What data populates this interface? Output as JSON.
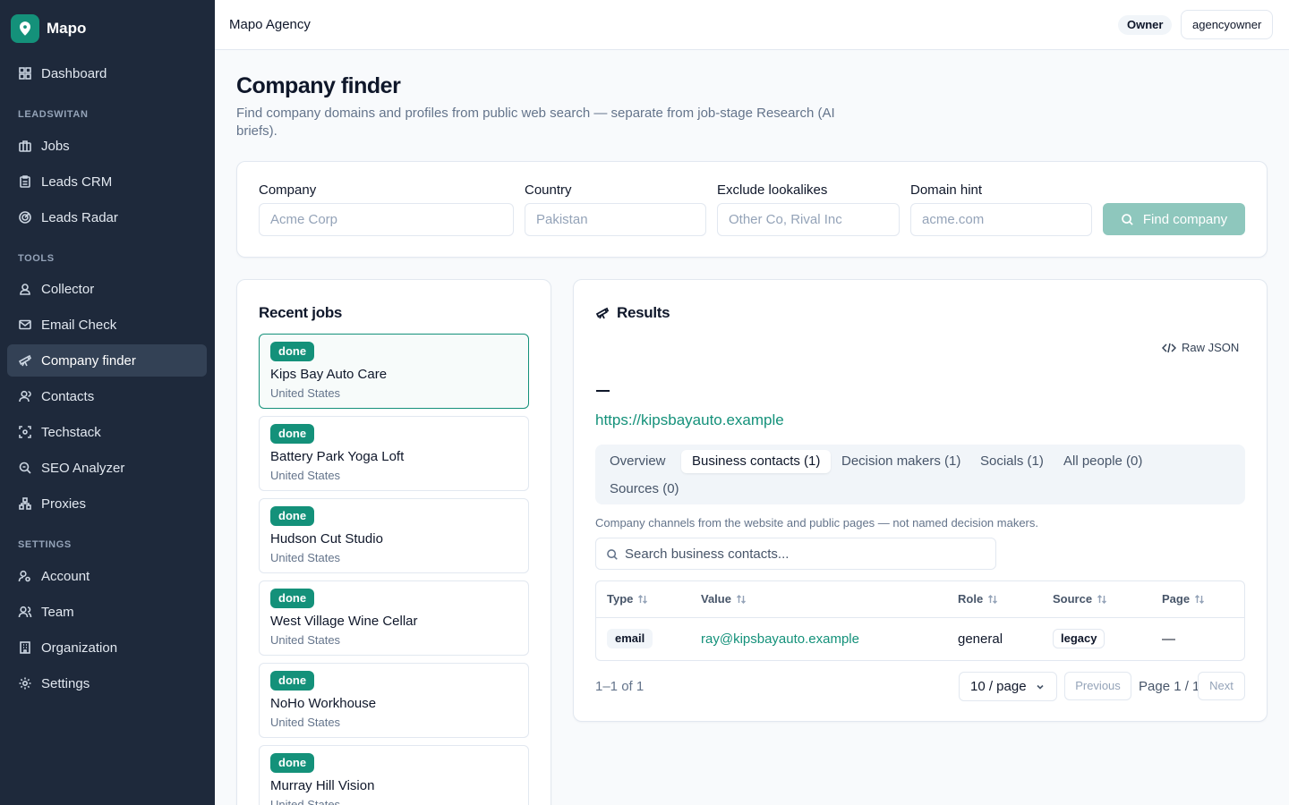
{
  "brand": {
    "name": "Mapo"
  },
  "sidebar": {
    "dashboard": "Dashboard",
    "sections": {
      "leadswitan": "LEADSWITAN",
      "tools": "TOOLS",
      "settings": "SETTINGS"
    },
    "items": {
      "jobs": "Jobs",
      "leads_crm": "Leads CRM",
      "leads_radar": "Leads Radar",
      "collector": "Collector",
      "email_check": "Email Check",
      "company_finder": "Company finder",
      "contacts": "Contacts",
      "techstack": "Techstack",
      "seo_analyzer": "SEO Analyzer",
      "proxies": "Proxies",
      "account": "Account",
      "team": "Team",
      "organization": "Organization",
      "settings": "Settings"
    },
    "active_item": "Company finder"
  },
  "topbar": {
    "org": "Mapo Agency",
    "role": "Owner",
    "user": "agencyowner"
  },
  "page": {
    "title": "Company finder",
    "description": "Find company domains and profiles from public web search — separate from job-stage Research (AI briefs)."
  },
  "form": {
    "company": {
      "label": "Company",
      "placeholder": "Acme Corp"
    },
    "country": {
      "label": "Country",
      "placeholder": "Pakistan"
    },
    "exclude": {
      "label": "Exclude lookalikes",
      "placeholder": "Other Co, Rival Inc"
    },
    "domain": {
      "label": "Domain hint",
      "placeholder": "acme.com"
    },
    "submit": "Find company"
  },
  "recent_jobs": {
    "title": "Recent jobs",
    "items": [
      {
        "status": "done",
        "name": "Kips Bay Auto Care",
        "country": "United States"
      },
      {
        "status": "done",
        "name": "Battery Park Yoga Loft",
        "country": "United States"
      },
      {
        "status": "done",
        "name": "Hudson Cut Studio",
        "country": "United States"
      },
      {
        "status": "done",
        "name": "West Village Wine Cellar",
        "country": "United States"
      },
      {
        "status": "done",
        "name": "NoHo Workhouse",
        "country": "United States"
      },
      {
        "status": "done",
        "name": "Murray Hill Vision",
        "country": "United States"
      }
    ]
  },
  "results": {
    "title": "Results",
    "raw_json": "Raw JSON",
    "url": "https://kipsbayauto.example",
    "tabs": [
      "Overview",
      "Business contacts (1)",
      "Decision makers (1)",
      "Socials (1)",
      "All people (0)",
      "Sources (0)"
    ],
    "active_tab": "Business contacts (1)",
    "hint": "Company channels from the website and public pages — not named decision makers.",
    "search_placeholder": "Search business contacts...",
    "table": {
      "headers": [
        "Type",
        "Value",
        "Role",
        "Source",
        "Page"
      ],
      "rows": [
        {
          "type": "email",
          "value": "ray@kipsbayauto.example",
          "role": "general",
          "source": "legacy",
          "page": "—"
        }
      ]
    },
    "count": "1–1 of 1",
    "page_size": "10 / page",
    "previous": "Previous",
    "page_label": "Page 1 / 1",
    "next": "Next"
  },
  "colors": {
    "sidebar_bg": "#1e293b",
    "accent": "#14917a",
    "accent_disabled": "#8ec7bd"
  }
}
